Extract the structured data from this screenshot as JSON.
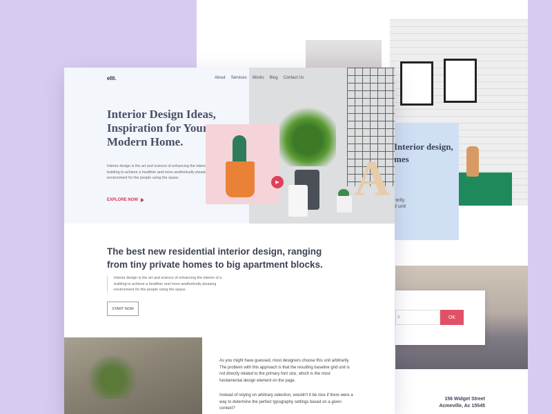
{
  "background_page": {
    "heading_line1": "Interior design,",
    "heading_line2": "mes",
    "text_line1": "rarily.",
    "text_line2": "d unit",
    "email_placeholder": "s",
    "ok_label": "OK",
    "address_line1": "156 Widget Street",
    "address_line2": "Acmeville, Ac 15545"
  },
  "main_page": {
    "logo": "elit",
    "logo_dot": ".",
    "nav": [
      "About",
      "Services",
      "Works",
      "Blog",
      "Contact Us"
    ],
    "hero": {
      "title": "Interior Design Ideas, Inspiration for Your Modern Home.",
      "description": "Interior design is the art and science of enhancing the interior of a building to achieve a healthier and more aesthetically pleasing environment for the people using the space.",
      "cta": "EXPLORE NOW",
      "decor_letter": "A"
    },
    "section": {
      "title": "The best new residential interior design, ranging from tiny private homes to big apartment blocks.",
      "description": "Interior design is the art and science of enhancing the interior of a building to achieve a healthier and more aesthetically pleasing environment for the people using the space.",
      "button": "START NOW"
    },
    "article": {
      "p1": "As you might have guessed, most designers choose this unit arbitrarily. The problem with this approach is that the resulting baseline grid unit is not directly related to the primary font size, which is the most fundamental design element on the page.",
      "p2": "Instead of relying on arbitrary selection, wouldn't it be nice if there were a way to determine the perfect typography settings based on a given context?"
    }
  },
  "colors": {
    "background": "#d7ccf0",
    "accent": "#d8334d",
    "heading": "#3d4256",
    "ok_button": "#e05168"
  }
}
